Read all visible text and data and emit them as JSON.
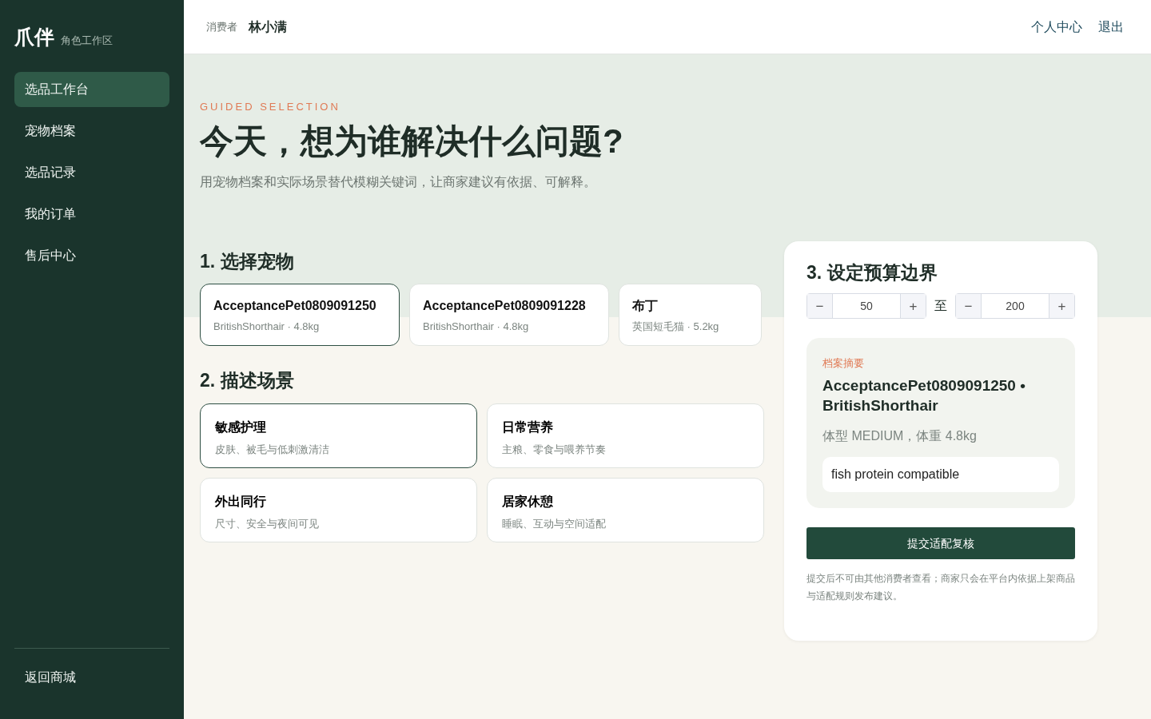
{
  "brand": {
    "logo": "爪伴",
    "subtitle": "角色工作区"
  },
  "sidebar": {
    "items": [
      {
        "label": "选品工作台",
        "selected": true
      },
      {
        "label": "宠物档案",
        "selected": false
      },
      {
        "label": "选品记录",
        "selected": false
      },
      {
        "label": "我的订单",
        "selected": false
      },
      {
        "label": "售后中心",
        "selected": false
      }
    ],
    "footer_link": "返回商城"
  },
  "topbar": {
    "role": "消费者",
    "user": "林小满",
    "links": [
      "个人中心",
      "退出"
    ]
  },
  "hero": {
    "eyebrow": "GUIDED SELECTION",
    "title": "今天，想为谁解决什么问题?",
    "subtitle": "用宠物档案和实际场景替代模糊关键词，让商家建议有依据、可解释。"
  },
  "pets": {
    "heading": "1. 选择宠物",
    "items": [
      {
        "name": "AcceptancePet0809091250",
        "meta": "BritishShorthair · 4.8kg",
        "selected": true
      },
      {
        "name": "AcceptancePet0809091228",
        "meta": "BritishShorthair · 4.8kg",
        "selected": false
      },
      {
        "name": "布丁",
        "meta": "英国短毛猫 · 5.2kg",
        "selected": false
      }
    ]
  },
  "scenes": {
    "heading": "2. 描述场景",
    "items": [
      {
        "title": "敏感护理",
        "desc": "皮肤、被毛与低刺激清洁",
        "selected": true
      },
      {
        "title": "日常营养",
        "desc": "主粮、零食与喂养节奏",
        "selected": false
      },
      {
        "title": "外出同行",
        "desc": "尺寸、安全与夜间可见",
        "selected": false
      },
      {
        "title": "居家休憩",
        "desc": "睡眠、互动与空间适配",
        "selected": false
      }
    ]
  },
  "budget": {
    "heading": "3. 设定预算边界",
    "min": {
      "minus": "−",
      "value": "50",
      "plus": "+"
    },
    "separator": "至",
    "max": {
      "minus": "−",
      "value": "200",
      "plus": "+"
    }
  },
  "summary": {
    "label": "档案摘要",
    "title": "AcceptancePet0809091250 • BritishShorthair",
    "detail": "体型 MEDIUM，体重 4.8kg",
    "note": "fish protein compatible"
  },
  "submit": {
    "label": "提交适配复核",
    "notice": "提交后不可由其他消费者查看；商家只会在平台内依据上架商品与适配规则发布建议。"
  }
}
